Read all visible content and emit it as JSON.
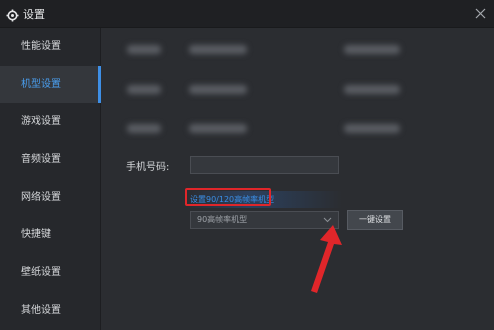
{
  "window": {
    "title": "设置"
  },
  "sidebar": {
    "items": [
      {
        "label": "性能设置"
      },
      {
        "label": "机型设置"
      },
      {
        "label": "游戏设置"
      },
      {
        "label": "音频设置"
      },
      {
        "label": "网络设置"
      },
      {
        "label": "快捷键"
      },
      {
        "label": "壁纸设置"
      },
      {
        "label": "其他设置"
      }
    ],
    "active_index": 1
  },
  "main": {
    "phone_label": "手机号码:",
    "phone_value": "",
    "hint_link": "设置90/120高帧率机型",
    "model_select": {
      "selected": "90高帧率机型"
    },
    "apply_button": "一键设置"
  },
  "colors": {
    "accent": "#3b8fe8",
    "highlight_box": "#e0262a",
    "annotation_arrow": "#e0262a",
    "background": "#2b2d31"
  },
  "icons": {
    "title": "gear-icon",
    "close": "close-icon",
    "select": "chevron-down-icon",
    "annotation": "arrow-icon"
  }
}
